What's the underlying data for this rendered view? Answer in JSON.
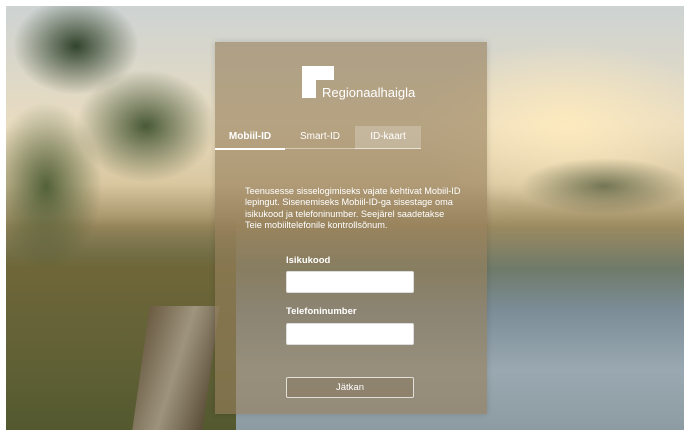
{
  "brand": {
    "name": "Regionaalhaigla",
    "logo_icon": "regionaalhaigla-logo-icon"
  },
  "tabs": [
    {
      "label": "Mobiil-ID",
      "active": true
    },
    {
      "label": "Smart-ID",
      "active": false
    },
    {
      "label": "ID-kaart",
      "active": false
    }
  ],
  "login": {
    "intro": "Teenusesse sisselogimiseks vajate kehtivat Mobiil-ID lepingut. Sisenemiseks Mobiil-ID-ga sisestage oma isikukood ja telefoninumber. Seejärel saadetakse Teie mobiiltelefonile kontrollsõnum.",
    "personal_code_label": "Isikukood",
    "personal_code_value": "",
    "phone_label": "Telefoninumber",
    "phone_value": "",
    "submit_label": "Jätkan"
  },
  "colors": {
    "panel": "#96805c",
    "text": "#ffffff",
    "input_bg": "#ffffff"
  }
}
